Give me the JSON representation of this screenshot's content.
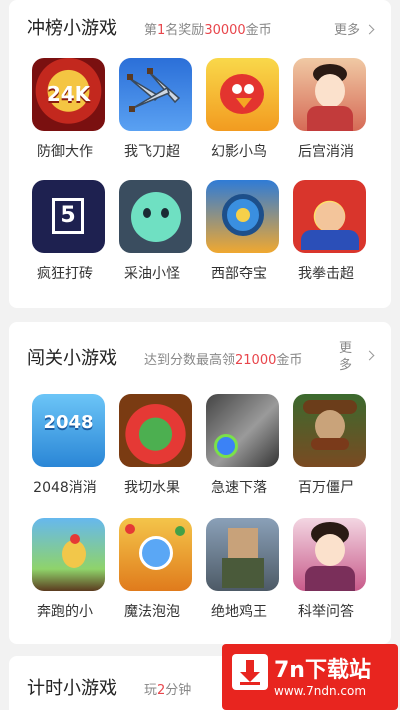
{
  "sections": [
    {
      "title": "冲榜小游戏",
      "subtitle_pre": "第",
      "subtitle_hl1": "1",
      "subtitle_mid": "名奖励",
      "subtitle_hl2": "30000",
      "subtitle_post": "金币",
      "more_label": "更多",
      "games": [
        {
          "name": "防御大作",
          "icon": "24k-coin-icon",
          "art_text": "24K"
        },
        {
          "name": "我飞刀超",
          "icon": "flying-knife-icon"
        },
        {
          "name": "幻影小鸟",
          "icon": "angry-bird-icon"
        },
        {
          "name": "后宫消消",
          "icon": "palace-lady-icon"
        },
        {
          "name": "疯狂打砖",
          "icon": "number-block-icon",
          "art_text": "5"
        },
        {
          "name": "采油小怪",
          "icon": "green-monster-icon"
        },
        {
          "name": "西部夺宝",
          "icon": "treasure-wheel-icon"
        },
        {
          "name": "我拳击超",
          "icon": "comic-punch-icon"
        }
      ]
    },
    {
      "title": "闯关小游戏",
      "subtitle_pre": "达到分数最高领",
      "subtitle_hl2": "21000",
      "subtitle_post": "金币",
      "more_label": "更多",
      "games": [
        {
          "name": "2048消消",
          "icon": "2048-tiles-icon",
          "art_text": "2048"
        },
        {
          "name": "我切水果",
          "icon": "fruit-slice-icon"
        },
        {
          "name": "急速下落",
          "icon": "falling-planet-icon"
        },
        {
          "name": "百万僵尸",
          "icon": "zombie-cowboy-icon"
        },
        {
          "name": "奔跑的小",
          "icon": "running-chicken-icon"
        },
        {
          "name": "魔法泡泡",
          "icon": "magic-bubble-icon"
        },
        {
          "name": "绝地鸡王",
          "icon": "soldier-icon"
        },
        {
          "name": "科举问答",
          "icon": "scholar-lady-icon"
        }
      ]
    },
    {
      "title": "计时小游戏",
      "subtitle_pre": "玩",
      "subtitle_hl2": "2",
      "subtitle_post": "分钟"
    }
  ],
  "watermark": {
    "title": "7n下载站",
    "url": "www.7ndn.com",
    "icon": "download-arrow-icon"
  },
  "colors": {
    "highlight": "#e8454b",
    "watermark_bg": "#e8251f"
  }
}
